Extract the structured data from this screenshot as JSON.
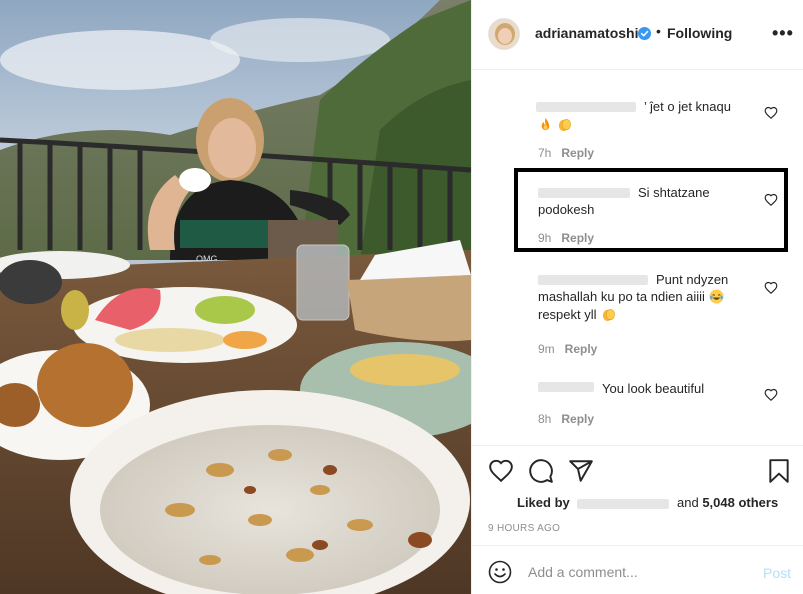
{
  "post": {
    "username": "adrianamatoshi",
    "verified": true,
    "separator": "•",
    "follow_state": "Following",
    "more_label": "•••"
  },
  "photo": {
    "subject": "woman at breakfast table on terrace",
    "shirt_print": "OMG"
  },
  "comments": [
    {
      "text": "’ ĵet o jet knaqu",
      "emoji": [
        "fire-emoji",
        "clapping-hands-emoji"
      ],
      "time": "7h",
      "reply": "Reply"
    },
    {
      "text_line1": "Si shtatzane",
      "text_line2": "podokesh",
      "time": "9h",
      "reply": "Reply",
      "highlighted": true
    },
    {
      "text_line1": "Punt ndyzen",
      "text_line2": "mashallah ku po ta ndien aiiii",
      "text_line3": "respekt yll",
      "emoji": [
        "laughing-emoji",
        "clapping-hands-emoji"
      ],
      "time": "9m",
      "reply": "Reply"
    },
    {
      "text": "You look beautiful",
      "time": "8h",
      "reply": "Reply"
    }
  ],
  "actions": {
    "liked_by_prefix": "Liked by",
    "and_label": "and",
    "others_count": "5,048 others",
    "time_ago": "9 HOURS AGO"
  },
  "composer": {
    "placeholder": "Add a comment...",
    "post_label": "Post"
  },
  "colors": {
    "text": "#262626",
    "secondary": "#8e8e8e",
    "border": "#efefef",
    "verified": "#3897f0",
    "post_disabled": "#b2dffc",
    "highlight_box": "#000000"
  }
}
